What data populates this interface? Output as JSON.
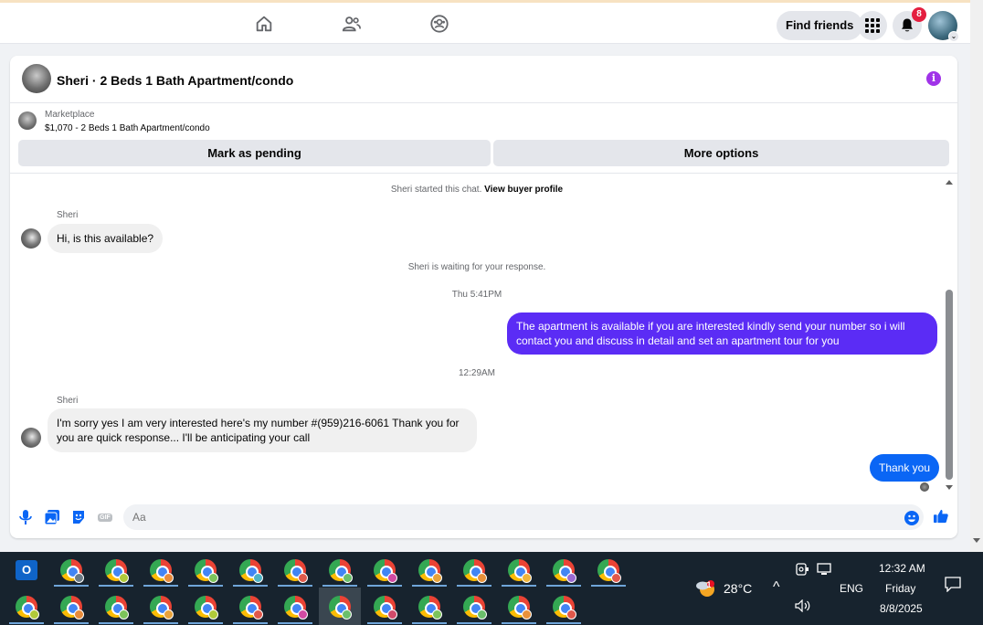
{
  "topbar": {
    "find_friends_label": "Find friends",
    "notification_count": "8"
  },
  "chat": {
    "title": "Sheri · 2 Beds 1 Bath Apartment/condo",
    "marketplace_label": "Marketplace",
    "listing": "$1,070 - 2 Beds 1 Bath Apartment/condo",
    "mark_pending_label": "Mark as pending",
    "more_options_label": "More options",
    "started_text": "Sheri started this chat.",
    "view_profile_link": "View buyer profile",
    "messages": [
      {
        "sender": "Sheri",
        "text": "Hi, is this available?"
      },
      {
        "system": "Sheri is waiting for your response."
      },
      {
        "timestamp": "Thu 5:41PM"
      },
      {
        "text": "The apartment is available if you are interested kindly send your number so i will contact you and discuss in detail and set an apartment tour for you"
      },
      {
        "timestamp": "12:29AM"
      },
      {
        "sender": "Sheri",
        "text": "I'm sorry yes I am very interested here's my number #(959)216-6061   Thank you for you are quick response... I'll be anticipating your call"
      },
      {
        "text": "Thank you"
      }
    ],
    "input_placeholder": "Aa"
  },
  "taskbar": {
    "weather_temp": "28°C",
    "language": "ENG",
    "time": "12:32 AM",
    "day": "Friday",
    "date": "8/8/2025",
    "outlook_badge": "1"
  },
  "colors": {
    "outgoing_bubble": "#5b2cf5",
    "outgoing_bubble_recent": "#0a66f5",
    "info_icon": "#a033e8",
    "badge": "#e41e3f",
    "taskbar_bg": "#17232e"
  }
}
